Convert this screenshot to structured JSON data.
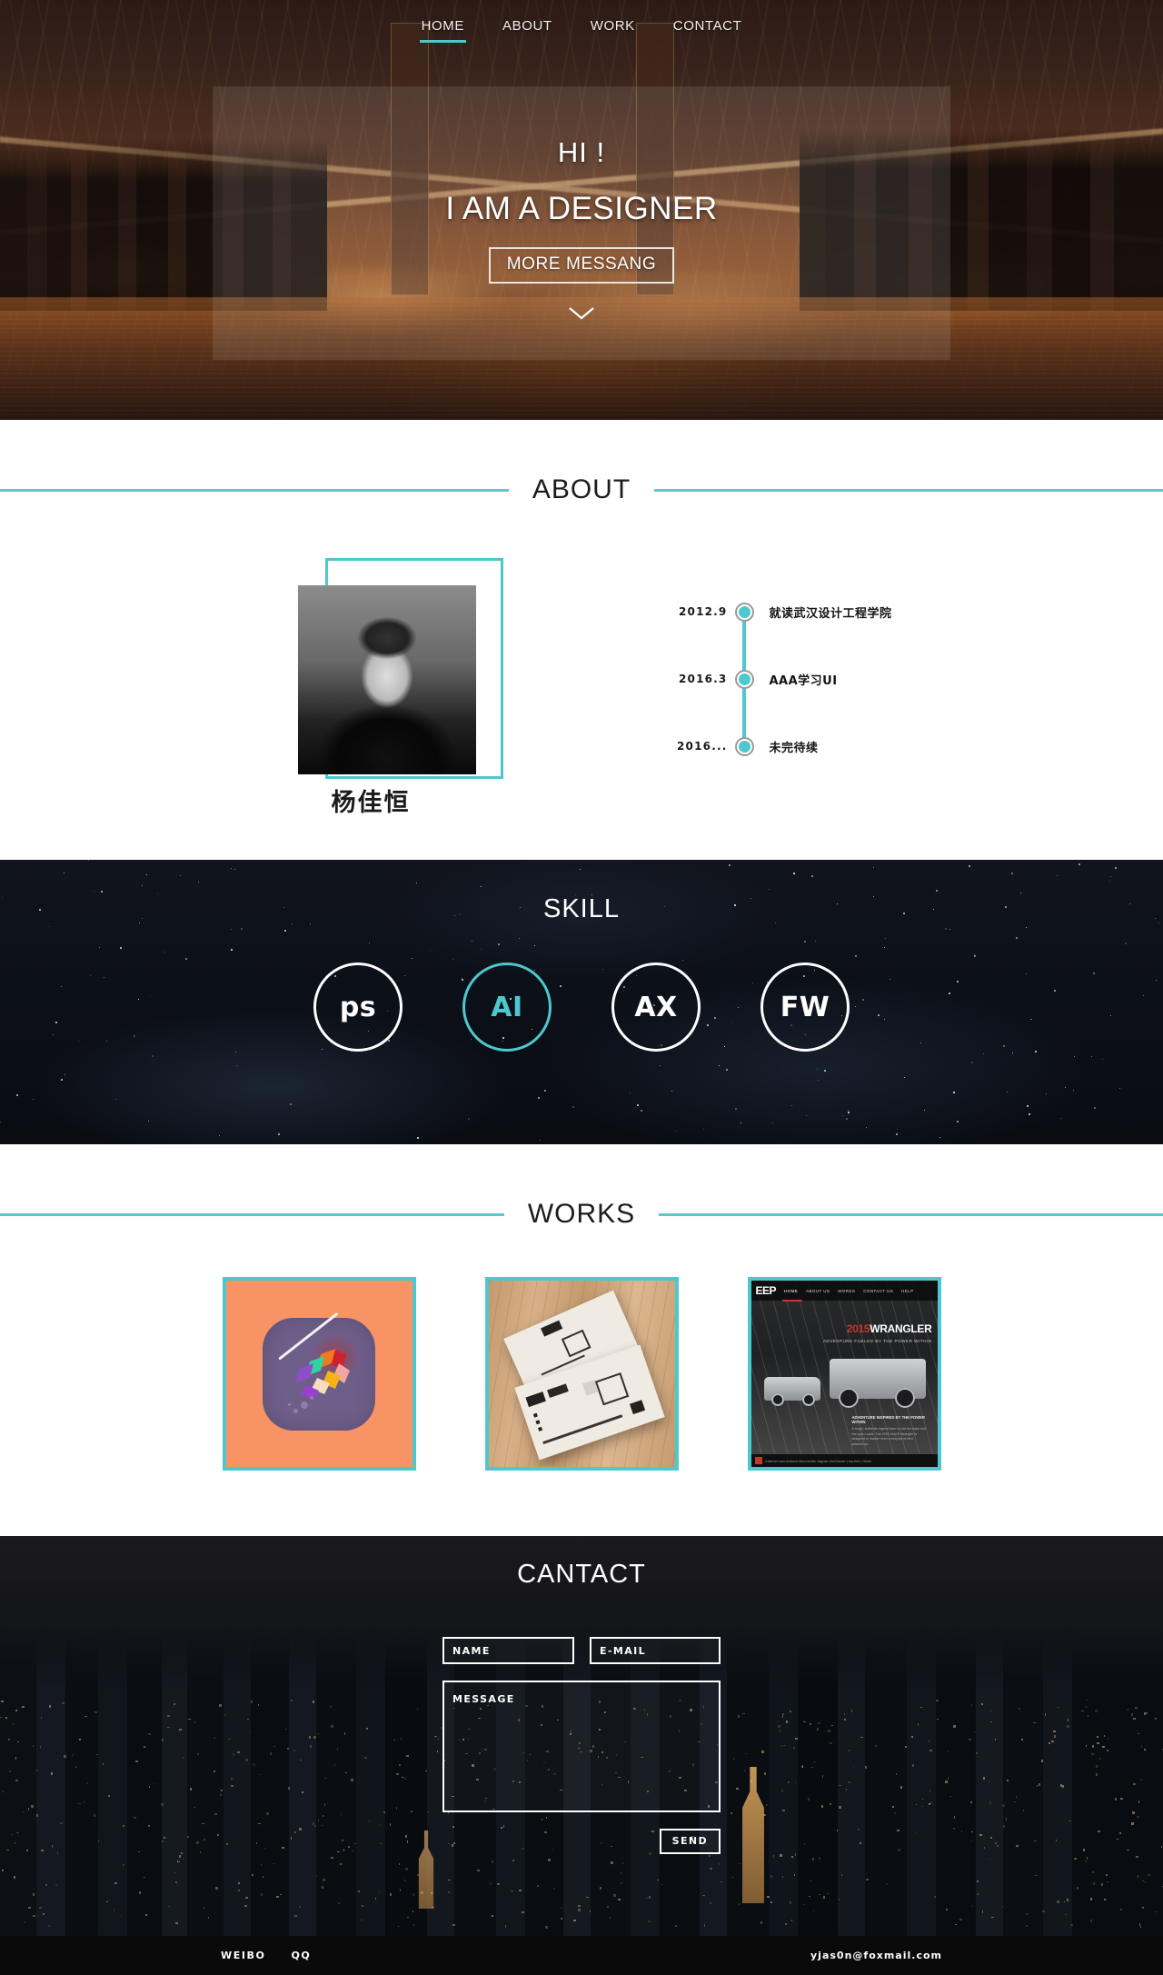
{
  "nav": {
    "items": [
      {
        "label": "HOME",
        "active": true
      },
      {
        "label": "ABOUT",
        "active": false
      },
      {
        "label": "WORK",
        "active": false
      },
      {
        "label": "CONTACT",
        "active": false
      }
    ]
  },
  "hero": {
    "greeting": "HI !",
    "headline": "I AM A DESIGNER",
    "cta_label": "MORE MESSANG",
    "scroll_icon": "chevron-down-icon"
  },
  "about": {
    "title": "ABOUT",
    "person_name": "杨佳恒",
    "timeline": [
      {
        "date": "2012.9",
        "text": "就读武汉设计工程学院"
      },
      {
        "date": "2016.3",
        "text": "AAA学习UI"
      },
      {
        "date": "2016...",
        "text": "未完待续"
      }
    ]
  },
  "skill": {
    "title": "SKILL",
    "items": [
      {
        "label": "ps",
        "highlighted": false
      },
      {
        "label": "AI",
        "highlighted": true
      },
      {
        "label": "AX",
        "highlighted": false
      },
      {
        "label": "FW",
        "highlighted": false
      }
    ]
  },
  "works": {
    "title": "WORKS",
    "items": [
      {
        "name": "feather-app-icon"
      },
      {
        "name": "business-card-mockup"
      },
      {
        "name": "jeep-wrangler-website"
      }
    ],
    "jeep": {
      "logo": "EEP",
      "nav": [
        "HOME",
        "ABOUT US",
        "WORKS",
        "CONTACT US",
        "HELP"
      ],
      "year": "2015",
      "model": "WRANGLER",
      "tagline": "ADVENTURE FUELED BY THE POWER WITHIN",
      "body_title": "ADVENTURE INSPIRED BY THE POWER WITHIN",
      "body_text": "A tough, authentic legend born to rule the trails and the open roads. The 2015 Jeep® Wrangler is designed to master even a long list of life's adventures."
    }
  },
  "contact": {
    "title": "CANTACT",
    "fields": {
      "name_placeholder": "NAME",
      "email_placeholder": "E-MAIL",
      "message_placeholder": "MESSAGE"
    },
    "send_label": "SEND"
  },
  "footer": {
    "links": [
      "WEIBO",
      "QQ"
    ],
    "email": "yjas0n@foxmail.com"
  },
  "colors": {
    "accent_teal": "#4ec8cf",
    "dark": "#0a0d14"
  }
}
